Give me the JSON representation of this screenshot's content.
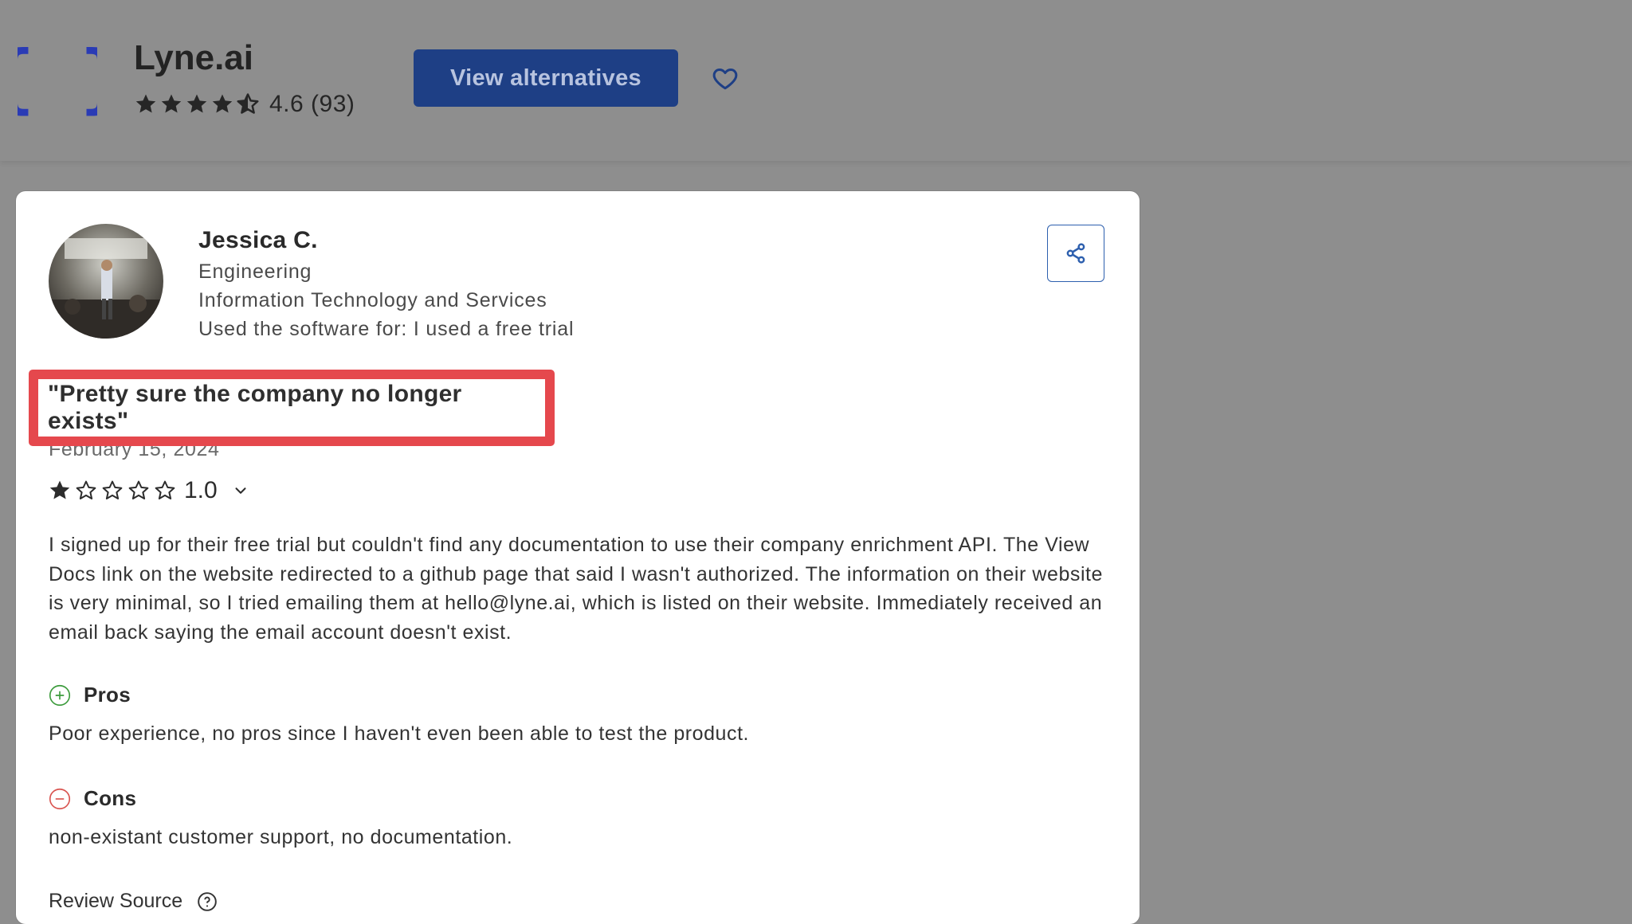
{
  "product": {
    "name": "Lyne.ai",
    "logo_glyph": "{ }",
    "rating_text": "4.6 (93)",
    "rating_value": 4.6,
    "alternatives_button": "View alternatives",
    "favorite_icon": "heart-icon"
  },
  "review": {
    "reviewer": {
      "name": "Jessica C.",
      "role": "Engineering",
      "industry": "Information Technology and Services",
      "usage": "Used the software for: I used a free trial"
    },
    "title": "\"Pretty sure the company no longer exists\"",
    "date": "February 15, 2024",
    "score": "1.0",
    "stars": 1,
    "body": "I signed up for their free trial but couldn't find any documentation to use their company enrichment API. The View Docs link on the website redirected to a github page that said I wasn't authorized. The information on their website is very minimal, so I tried emailing them at hello@lyne.ai, which is listed on their website. Immediately received an email back saying the email account doesn't exist.",
    "pros_label": "Pros",
    "pros_text": "Poor experience, no pros since I haven't even been able to test the product.",
    "cons_label": "Cons",
    "cons_text": "non-existant customer support, no documentation.",
    "next_label": "Review Source"
  },
  "colors": {
    "overlay_bg": "#8e8e8e",
    "brand_blue": "#1e3f85",
    "logo_blue": "#2a3bb5",
    "highlight_red": "#e5484d",
    "pros_green": "#3c9b3c",
    "cons_red": "#d9534f"
  }
}
